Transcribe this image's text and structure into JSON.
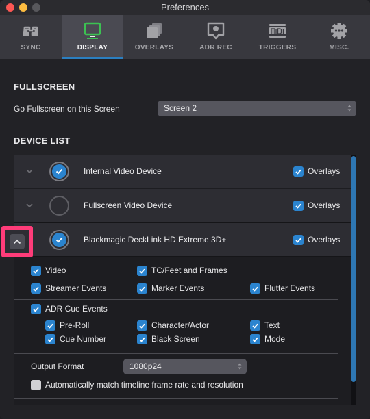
{
  "window": {
    "title": "Preferences"
  },
  "tabs": [
    {
      "label": "SYNC",
      "icon": "sync-link-icon",
      "active": false
    },
    {
      "label": "DISPLAY",
      "icon": "monitor-icon",
      "active": true
    },
    {
      "label": "OVERLAYS",
      "icon": "overlays-stack-icon",
      "active": false
    },
    {
      "label": "ADR REC",
      "icon": "adr-record-icon",
      "active": false
    },
    {
      "label": "TRIGGERS",
      "icon": "midi-icon",
      "active": false
    },
    {
      "label": "MISC.",
      "icon": "gear-icon",
      "active": false
    }
  ],
  "fullscreen": {
    "section_title": "FULLSCREEN",
    "label": "Go Fullscreen on this Screen",
    "selected_screen": "Screen 2"
  },
  "device_list": {
    "section_title": "DEVICE LIST",
    "devices": [
      {
        "name": "Internal Video Device",
        "enabled": true,
        "overlays_label": "Overlays",
        "overlays": true,
        "expanded": false
      },
      {
        "name": "Fullscreen Video Device",
        "enabled": false,
        "overlays_label": "Overlays",
        "overlays": true,
        "expanded": false
      },
      {
        "name": "Blackmagic DeckLink HD Extreme 3D+",
        "enabled": true,
        "overlays_label": "Overlays",
        "overlays": true,
        "expanded": true
      }
    ],
    "options": {
      "video": {
        "label": "Video",
        "checked": true
      },
      "tc_feet_frames": {
        "label": "TC/Feet and Frames",
        "checked": true
      },
      "streamer_events": {
        "label": "Streamer Events",
        "checked": true
      },
      "marker_events": {
        "label": "Marker Events",
        "checked": true
      },
      "flutter_events": {
        "label": "Flutter Events",
        "checked": true
      },
      "adr_cue_events": {
        "label": "ADR Cue Events",
        "checked": true
      },
      "pre_roll": {
        "label": "Pre-Roll",
        "checked": true
      },
      "character_actor": {
        "label": "Character/Actor",
        "checked": true
      },
      "text": {
        "label": "Text",
        "checked": true
      },
      "cue_number": {
        "label": "Cue Number",
        "checked": true
      },
      "black_screen": {
        "label": "Black Screen",
        "checked": true
      },
      "mode": {
        "label": "Mode",
        "checked": true
      }
    },
    "output_format": {
      "label": "Output Format",
      "value": "1080p24"
    },
    "auto_match": {
      "label": "Automatically match timeline frame rate and resolution",
      "checked": false
    }
  },
  "colors": {
    "accent": "#2b84cf",
    "active_tab_icon": "#3cc152",
    "highlight_box": "#ff3c79"
  }
}
